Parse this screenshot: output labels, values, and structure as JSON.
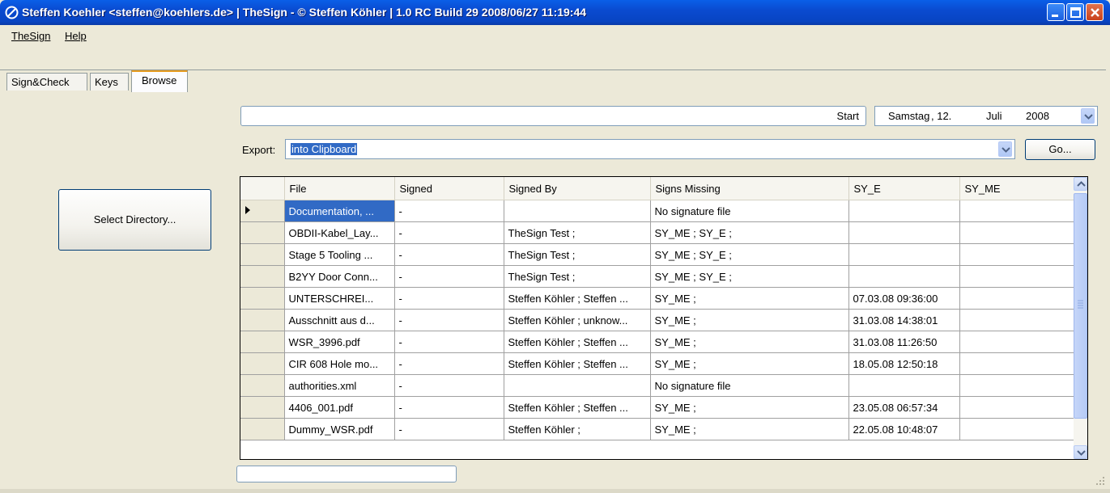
{
  "window": {
    "title": "Steffen Koehler <steffen@koehlers.de> | TheSign - © Steffen Köhler  | 1.0 RC  Build 29 2008/06/27 11:19:44"
  },
  "menu": [
    {
      "label": "TheSign"
    },
    {
      "label": "Help"
    }
  ],
  "tabs": [
    {
      "label": "Sign&Check"
    },
    {
      "label": "Keys"
    },
    {
      "label": "Browse"
    }
  ],
  "left": {
    "select_directory_label": "Select Directory..."
  },
  "toolbar": {
    "start_label": "Start",
    "date": {
      "weekday": "Samstag",
      "day": ", 12.",
      "month": "Juli",
      "year": "2008"
    }
  },
  "export": {
    "label": "Export:",
    "value": "into Clipboard",
    "go_label": "Go..."
  },
  "grid": {
    "columns": [
      "File",
      "Signed",
      "Signed By",
      "Signs Missing",
      "SY_E",
      "SY_ME"
    ],
    "rows": [
      [
        "Documentation, ...",
        "-",
        "",
        "No signature file",
        "",
        ""
      ],
      [
        "OBDII-Kabel_Lay...",
        "-",
        "TheSign Test ;",
        "SY_ME ; SY_E ;",
        "",
        ""
      ],
      [
        "Stage 5 Tooling ...",
        "-",
        "TheSign Test ;",
        "SY_ME ; SY_E ;",
        "",
        ""
      ],
      [
        "B2YY Door Conn...",
        "-",
        "TheSign Test ;",
        "SY_ME ; SY_E ;",
        "",
        ""
      ],
      [
        "UNTERSCHREI...",
        "-",
        "Steffen Köhler ; Steffen ...",
        "SY_ME ;",
        "07.03.08 09:36:00",
        ""
      ],
      [
        "Ausschnitt aus d...",
        "-",
        "Steffen Köhler ; unknow...",
        "SY_ME ;",
        "31.03.08 14:38:01",
        ""
      ],
      [
        "WSR_3996.pdf",
        "-",
        "Steffen Köhler ; Steffen ...",
        "SY_ME ;",
        "31.03.08 11:26:50",
        ""
      ],
      [
        "CIR 608 Hole mo...",
        "-",
        "Steffen Köhler ; Steffen ...",
        "SY_ME ;",
        "18.05.08 12:50:18",
        ""
      ],
      [
        "authorities.xml",
        "-",
        "",
        "No signature file",
        "",
        ""
      ],
      [
        "4406_001.pdf",
        "-",
        "Steffen Köhler ; Steffen ...",
        "SY_ME ;",
        "23.05.08 06:57:34",
        ""
      ],
      [
        "Dummy_WSR.pdf",
        "-",
        "Steffen Köhler ;",
        "SY_ME ;",
        "22.05.08 10:48:07",
        ""
      ]
    ]
  },
  "icons": {
    "app": "no-entry-icon",
    "minimize": "minimize-icon",
    "maximize": "maximize-icon",
    "close": "close-icon",
    "dropdown": "chevron-down-icon",
    "current_row": "row-pointer-icon",
    "resize": "resize-grip-icon"
  },
  "colors": {
    "titlebar": "#0a4bd0",
    "selection": "#316ac5",
    "active_tab_accent": "#e79c1e"
  }
}
